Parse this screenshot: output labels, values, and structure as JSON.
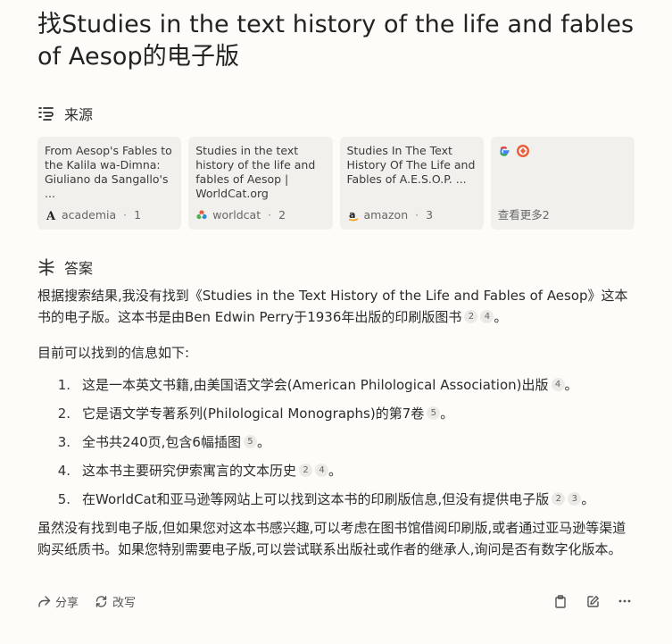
{
  "title": "找Studies in the text history of the life and fables of Aesop的电子版",
  "sources_section": {
    "title": "来源",
    "icon": "sources-icon"
  },
  "sources": [
    {
      "title": "From Aesop's Fables to the Kalila wa-Dimna: Giuliano da Sangallo's ...",
      "site": "academia",
      "index": "1",
      "icon": "academia-icon"
    },
    {
      "title": "Studies in the text history of the life and fables of Aesop | WorldCat.org",
      "site": "worldcat",
      "index": "2",
      "icon": "worldcat-icon"
    },
    {
      "title": "Studies In The Text History Of The Life and Fables of A.E.S.O.P. ...",
      "site": "amazon",
      "index": "3",
      "icon": "amazon-icon"
    }
  ],
  "more_sources": {
    "label": "查看更多2",
    "icons": [
      "google-icon",
      "shield-icon"
    ]
  },
  "answer_section": {
    "title": "答案",
    "icon": "answer-icon"
  },
  "answer": {
    "intro": "根据搜索结果,我没有找到《Studies in the Text History of the Life and Fables of Aesop》这本书的电子版。这本书是由Ben Edwin Perry于1936年出版的印刷版图书",
    "intro_cites": [
      "2",
      "4"
    ],
    "intro_end": "。",
    "info_heading": "目前可以找到的信息如下:",
    "items": [
      {
        "num": "1.",
        "text": "这是一本英文书籍,由美国语文学会(American Philological Association)出版",
        "cites": [
          "4"
        ]
      },
      {
        "num": "2.",
        "text": "它是语文学专著系列(Philological Monographs)的第7卷",
        "cites": [
          "5"
        ]
      },
      {
        "num": "3.",
        "text": "全书共240页,包含6幅插图",
        "cites": [
          "5"
        ]
      },
      {
        "num": "4.",
        "text": "这本书主要研究伊索寓言的文本历史",
        "cites": [
          "2",
          "4"
        ]
      },
      {
        "num": "5.",
        "text": "在WorldCat和亚马逊等网站上可以找到这本书的印刷版信息,但没有提供电子版",
        "cites": [
          "2",
          "3"
        ]
      }
    ],
    "closing": "虽然没有找到电子版,但如果您对这本书感兴趣,可以考虑在图书馆借阅印刷版,或者通过亚马逊等渠道购买纸质书。如果您特别需要电子版,可以尝试联系出版社或作者的继承人,询问是否有数字化版本。"
  },
  "actions": {
    "share": "分享",
    "rewrite": "改写"
  },
  "colors": {
    "background": "#fdfcf9",
    "card": "#f1f0ec",
    "text": "#2b2b2b",
    "muted": "#666666"
  }
}
